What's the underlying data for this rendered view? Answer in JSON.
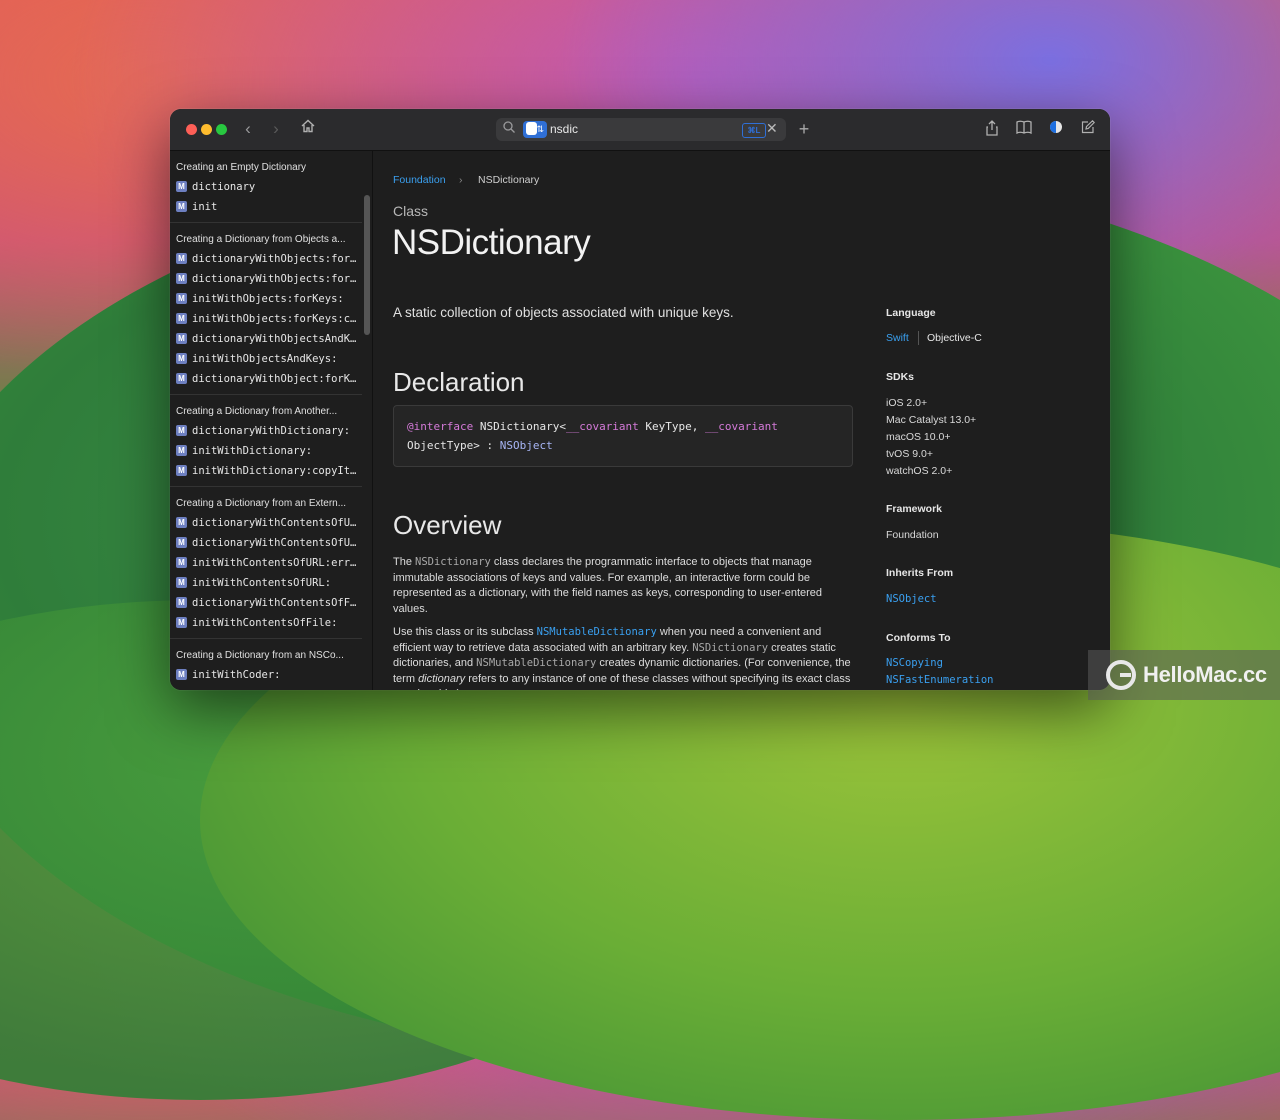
{
  "titlebar": {
    "search_query": "nsdic",
    "kbd_hint": "⌘L"
  },
  "sidebar": {
    "sections": [
      {
        "title": "Creating an Empty Dictionary",
        "items": [
          "dictionary",
          "init"
        ]
      },
      {
        "title": "Creating a Dictionary from Objects a...",
        "items": [
          "dictionaryWithObjects:for...",
          "dictionaryWithObjects:for...",
          "initWithObjects:forKeys:",
          "initWithObjects:forKeys:c...",
          "dictionaryWithObjectsAndK...",
          "initWithObjectsAndKeys:",
          "dictionaryWithObject:forK..."
        ]
      },
      {
        "title": "Creating a Dictionary from Another...",
        "items": [
          "dictionaryWithDictionary:",
          "initWithDictionary:",
          "initWithDictionary:copyIt..."
        ]
      },
      {
        "title": "Creating a Dictionary from an Extern...",
        "items": [
          "dictionaryWithContentsOfU...",
          "dictionaryWithContentsOfU...",
          "initWithContentsOfURL:err...",
          "initWithContentsOfURL:",
          "dictionaryWithContentsOfF...",
          "initWithContentsOfFile:"
        ]
      },
      {
        "title": "Creating a Dictionary from an NSCo...",
        "items": [
          "initWithCoder:"
        ]
      }
    ],
    "badge": "M"
  },
  "breadcrumb": {
    "parent": "Foundation",
    "separator": "›",
    "current": "NSDictionary"
  },
  "doc": {
    "kind": "Class",
    "title": "NSDictionary",
    "abstract": "A static collection of objects associated with unique keys.",
    "declaration_heading": "Declaration",
    "code": {
      "kw1": "@interface",
      "name": "NSDictionary<",
      "kw2": "__covariant",
      "t1": " KeyType, ",
      "kw3": "__covariant",
      "line2a": "ObjectType> : ",
      "line2b": "NSObject"
    },
    "overview_heading": "Overview",
    "p1": {
      "a": "The ",
      "code1": "NSDictionary",
      "b": " class declares the programmatic interface to objects that manage immutable associations of keys and values. For example, an interactive form could be represented as a dictionary, with the field names as keys, corresponding to user-entered values."
    },
    "p2": {
      "a": "Use this class or its subclass ",
      "link1": "NSMutableDictionary",
      "b": " when you need a convenient and efficient way to retrieve data associated with an arbitrary key. ",
      "code1": "NSDictionary",
      "c": " creates static dictionaries, and ",
      "code2": "NSMutableDictionary",
      "d": " creates dynamic dictionaries. (For convenience, the term ",
      "em": "dictionary",
      "e": " refers to any instance of one of these classes without specifying its exact class membership.)"
    }
  },
  "aside": {
    "language_heading": "Language",
    "lang_swift": "Swift",
    "lang_objc": "Objective-C",
    "sdks_heading": "SDKs",
    "sdks": [
      "iOS 2.0+",
      "Mac Catalyst 13.0+",
      "macOS 10.0+",
      "tvOS 9.0+",
      "watchOS 2.0+"
    ],
    "framework_heading": "Framework",
    "framework": "Foundation",
    "inherits_heading": "Inherits From",
    "inherits": "NSObject",
    "conforms_heading": "Conforms To",
    "conforms": [
      "NSCopying",
      "NSFastEnumeration"
    ]
  },
  "watermark": {
    "text": "HelloMac.cc"
  },
  "colors": {
    "accent": "#3aa0f0",
    "keyword": "#d47ad8",
    "type": "#a7b5f5"
  }
}
